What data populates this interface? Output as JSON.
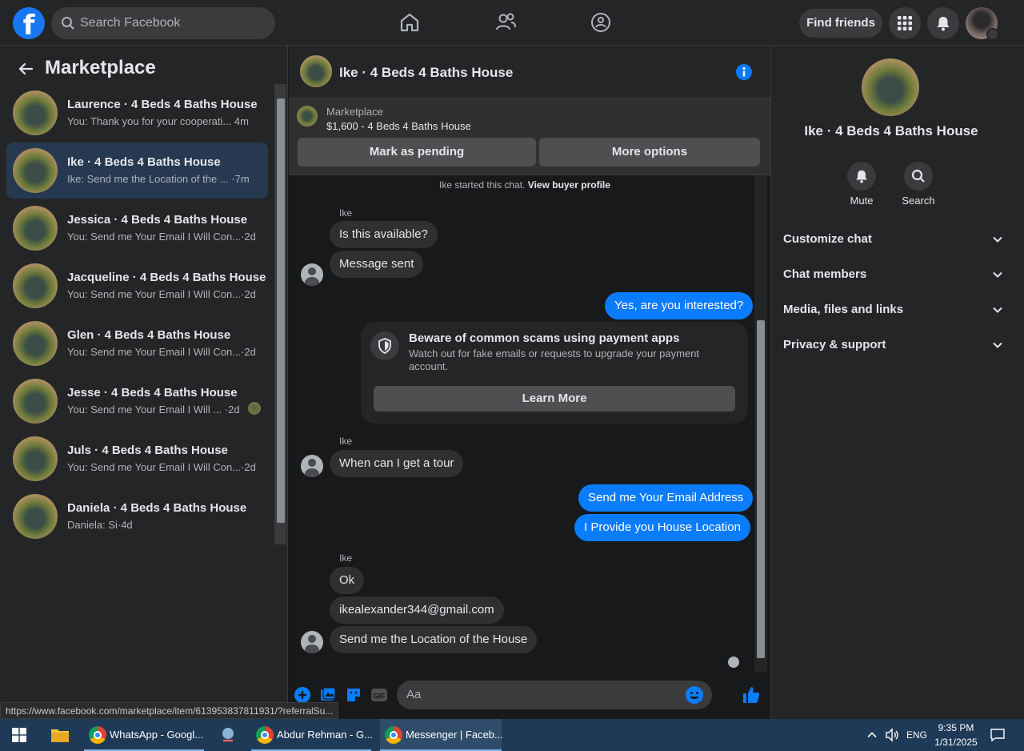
{
  "topbar": {
    "search_placeholder": "Search Facebook",
    "find_friends": "Find friends"
  },
  "sidebar": {
    "title": "Marketplace",
    "conversations": [
      {
        "name": "Laurence · 4 Beds 4 Baths House",
        "preview": "You: Thank you for your cooperati...",
        "time": "4m",
        "active": false
      },
      {
        "name": "Ike · 4 Beds 4 Baths House",
        "preview": "Ike: Send me the Location of the ...",
        "time": "·7m",
        "active": true
      },
      {
        "name": "Jessica · 4 Beds 4 Baths House",
        "preview": "You: Send me Your Email I Will Con...",
        "time": "·2d",
        "active": false
      },
      {
        "name": "Jacqueline · 4 Beds 4 Baths House",
        "preview": "You: Send me Your Email I Will Con...",
        "time": "·2d",
        "active": false
      },
      {
        "name": "Glen · 4 Beds 4 Baths House",
        "preview": "You: Send me Your Email I Will Con...",
        "time": "·2d",
        "active": false
      },
      {
        "name": "Jesse · 4 Beds 4 Baths House",
        "preview": "You: Send me Your Email I Will ...",
        "time": "·2d",
        "active": false
      },
      {
        "name": "Juls · 4 Beds 4 Baths House",
        "preview": "You: Send me Your Email I Will Con...",
        "time": "·2d",
        "active": false
      },
      {
        "name": "Daniela · 4 Beds 4 Baths House",
        "preview": "Daniela: Si",
        "time": "·4d",
        "active": false
      }
    ]
  },
  "chat": {
    "title": "Ike · 4 Beds 4 Baths House",
    "listing": {
      "label": "Marketplace",
      "price_title": "$1,600 - 4 Beds 4 Baths House",
      "mark_pending": "Mark as pending",
      "more_options": "More options"
    },
    "started_prefix": "Ike started this chat.",
    "started_link": "View buyer profile",
    "sender_label_1": "Ike",
    "sender_label_2": "Ike",
    "sender_label_3": "Ike",
    "messages": {
      "m1": "Is this available?",
      "m2": "Message sent",
      "m3": "Yes, are you interested?",
      "m4": "When can I get a tour",
      "m5": "Send me Your Email Address",
      "m6": "I Provide you House Location",
      "m7": "Ok",
      "m8": "ikealexander344@gmail.com",
      "m9": "Send me the Location of the House"
    },
    "scam_card": {
      "title": "Beware of common scams using payment apps",
      "body": "Watch out for fake emails or requests to upgrade your payment account.",
      "button": "Learn More"
    },
    "composer_placeholder": "Aa"
  },
  "right_panel": {
    "title": "Ike · 4 Beds 4 Baths House",
    "mute": "Mute",
    "search": "Search",
    "rows": [
      "Customize chat",
      "Chat members",
      "Media, files and links",
      "Privacy & support"
    ]
  },
  "status_url": "https://www.facebook.com/marketplace/item/613953837811931/?referralSu...",
  "taskbar": {
    "apps": [
      "WhatsApp - Googl...",
      "Abdur Rehman - G...",
      "Messenger | Faceb..."
    ],
    "lang": "ENG",
    "time": "9:35 PM",
    "date": "1/31/2025"
  },
  "colors": {
    "accent": "#0a7cff",
    "brand": "#1877f2",
    "active_row": "#263951"
  }
}
